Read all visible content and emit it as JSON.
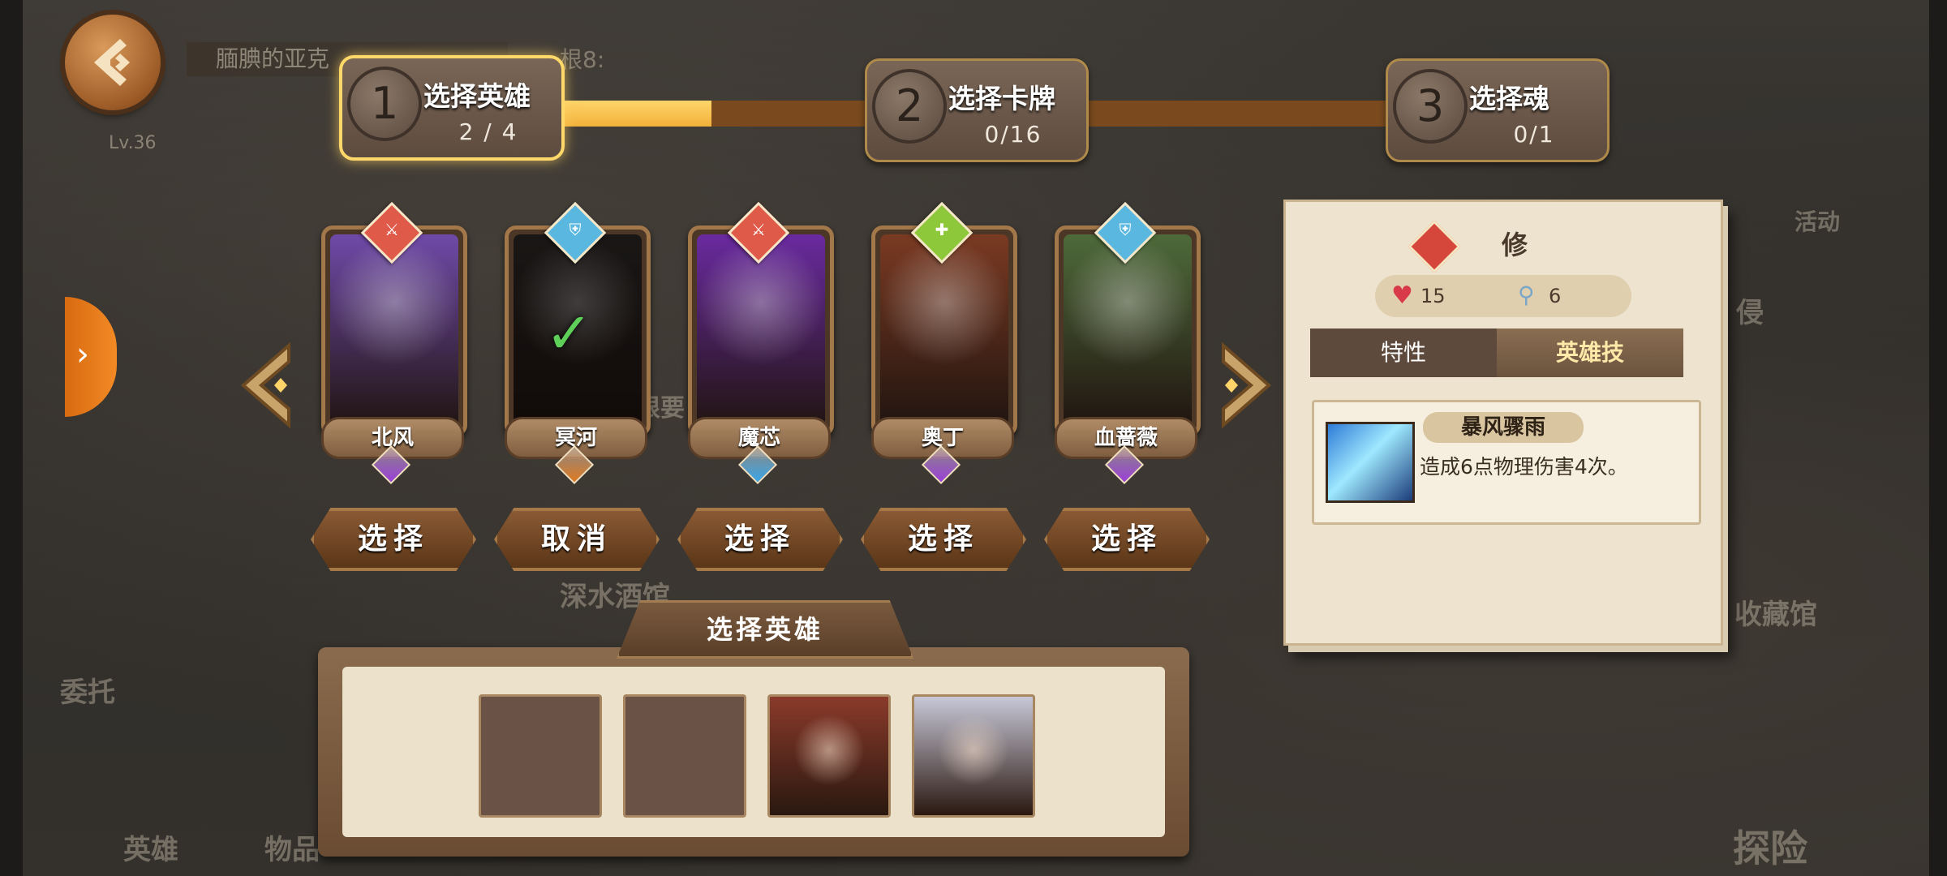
{
  "player": {
    "name": "腼腆的亚克",
    "level": "Lv.36"
  },
  "background": {
    "chat_snippet": "根8:",
    "tavern_label": "深水酒馆",
    "quest_label": "委托",
    "collection_label": "收藏馆",
    "event_label": "活动",
    "invade_label": "侵",
    "hero_nav_label": "英雄",
    "items_nav_label": "物品",
    "explore_label": "探险",
    "faded_text": "根要"
  },
  "steps": [
    {
      "num": "1",
      "title": "选择英雄",
      "count": "2 / 4",
      "active": true
    },
    {
      "num": "2",
      "title": "选择卡牌",
      "count": "0/16",
      "active": false
    },
    {
      "num": "3",
      "title": "选择魂",
      "count": "0/1",
      "active": false
    }
  ],
  "progress_fraction": 0.18,
  "heroes": [
    {
      "name": "北风",
      "badge_color": "#e05a4a",
      "badge_icon": "sword-icon",
      "gem_color": "#9b3fd8",
      "portrait_color": "#6f4aa8",
      "selected": false,
      "button": "选择"
    },
    {
      "name": "冥河",
      "badge_color": "#5ab8e0",
      "badge_icon": "shield-icon",
      "gem_color": "#e07a20",
      "portrait_color": "#2f2a28",
      "selected": true,
      "button": "取消"
    },
    {
      "name": "魔芯",
      "badge_color": "#e05a4a",
      "badge_icon": "sword-icon",
      "gem_color": "#3aa6e8",
      "portrait_color": "#6a2aa0",
      "selected": false,
      "button": "选择"
    },
    {
      "name": "奥丁",
      "badge_color": "#8cc83a",
      "badge_icon": "heal-icon",
      "gem_color": "#9b3fd8",
      "portrait_color": "#7a3a22",
      "selected": false,
      "button": "选择"
    },
    {
      "name": "血蔷薇",
      "badge_color": "#5ab8e0",
      "badge_icon": "shield-icon",
      "gem_color": "#9b3fd8",
      "portrait_color": "#4e6a3a",
      "selected": false,
      "button": "选择"
    }
  ],
  "selection_panel": {
    "title": "选择英雄",
    "slots": [
      {
        "state": "empty"
      },
      {
        "state": "empty"
      },
      {
        "state": "filled",
        "portrait_color": "#8a3a2a"
      },
      {
        "state": "filled",
        "portrait_color": "#c8c8d8"
      }
    ]
  },
  "info_panel": {
    "hero_name": "修",
    "class_icon": "sword-icon",
    "hp": "15",
    "speed": "6",
    "tabs": [
      "特性",
      "英雄技"
    ],
    "active_tab": "英雄技",
    "skill": {
      "name": "暴风骤雨",
      "description": "造成6点物理伤害4次。"
    }
  },
  "colors": {
    "accent_gold": "#ffd56a",
    "track": "#7a4a1e",
    "side_tab": "#f28a25"
  }
}
